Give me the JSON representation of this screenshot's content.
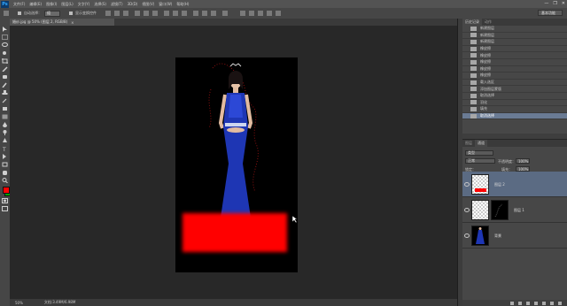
{
  "app": {
    "logo": "Ps"
  },
  "menu": [
    "文件(F)",
    "编辑(E)",
    "图像(I)",
    "图层(L)",
    "文字(Y)",
    "选择(S)",
    "滤镜(T)",
    "3D(D)",
    "视图(V)",
    "窗口(W)",
    "帮助(H)"
  ],
  "window_controls": [
    "—",
    "❐",
    "✕"
  ],
  "options": {
    "auto_select_label": "自动选择：",
    "auto_select_value": "组",
    "show_transform_label": "显示变换控件",
    "workspace": "基本功能"
  },
  "document": {
    "tab_title": "婚纱.jpg @ 50% (图层 2, RGB/8)",
    "tab_close": "×"
  },
  "status": {
    "zoom": "50%",
    "doc_size": "文档:3.49M/6.98M"
  },
  "history": {
    "tabs": [
      "历史记录",
      "动作"
    ],
    "items": [
      "新建图层",
      "新建图层",
      "新建图层",
      "橡皮擦",
      "橡皮擦",
      "橡皮擦",
      "橡皮擦",
      "橡皮擦",
      "载入选区",
      "添加图层蒙版",
      "取消选择",
      "羽化",
      "填充",
      "取消选择"
    ],
    "selected_index": 13
  },
  "layers": {
    "tabs": [
      "图层",
      "通道"
    ],
    "filter_label": "类型",
    "blend_mode": "正常",
    "opacity_label": "不透明度：",
    "opacity_value": "100%",
    "lock_label": "锁定：",
    "fill_label": "填充：",
    "fill_value": "100%",
    "list": [
      {
        "name": "图层 2",
        "selected": true
      },
      {
        "name": "图层 1",
        "selected": false
      },
      {
        "name": "背景",
        "selected": false
      }
    ]
  },
  "colors": {
    "foreground": "#ff0000",
    "background": "#00a000",
    "selection": "#5b6b83"
  }
}
